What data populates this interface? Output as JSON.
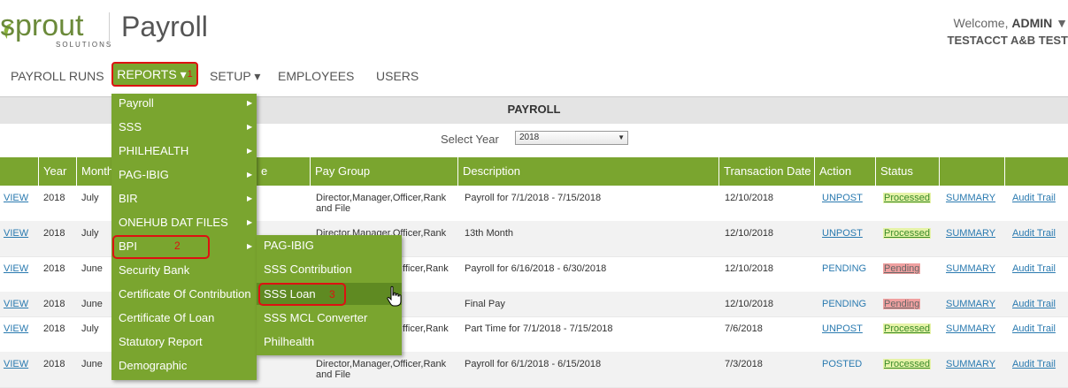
{
  "header": {
    "logo_word": "sprout",
    "logo_sub": "SOLUTIONS",
    "app_title": "Payroll",
    "welcome_prefix": "Welcome,",
    "welcome_user": "ADMIN",
    "company": "TESTACCT A&B TEST"
  },
  "nav": {
    "payroll_runs": "PAYROLL RUNS",
    "reports": "REPORTS ▾",
    "reports_badge": "1",
    "setup": "SETUP ▾",
    "employees": "EMPLOYEES",
    "users": "USERS"
  },
  "page": {
    "title": "PAYROLL",
    "year_label": "Select Year",
    "year_value": "2018"
  },
  "table": {
    "headers": [
      "Year",
      "Month",
      "Pay Group",
      "Description",
      "Transaction Date",
      "Action",
      "Status"
    ],
    "rows": [
      {
        "view": "VIEW",
        "year": "2018",
        "month": "July",
        "group1": "Director,Manager,Officer,Rank",
        "group2": "and File",
        "desc": "Payroll for 7/1/2018 - 7/15/2018",
        "date": "12/10/2018",
        "action": "UNPOST",
        "status": "Processed",
        "summary": "SUMMARY",
        "audit": "Audit Trail"
      },
      {
        "view": "VIEW",
        "year": "2018",
        "month": "July",
        "group1": "Director,Manager,Officer,Rank",
        "group2": "",
        "desc": "13th Month",
        "date": "12/10/2018",
        "action": "UNPOST",
        "status": "Processed",
        "summary": "SUMMARY",
        "audit": "Audit Trail"
      },
      {
        "view": "VIEW",
        "year": "2018",
        "month": "June",
        "group1": "fficer,Rank",
        "group2": "",
        "desc": "Payroll for 6/16/2018 - 6/30/2018",
        "date": "12/10/2018",
        "action": "PENDING",
        "status": "Pending",
        "summary": "SUMMARY",
        "audit": "Audit Trail"
      },
      {
        "view": "VIEW",
        "year": "2018",
        "month": "June",
        "group1": "",
        "group2": "",
        "desc": "Final Pay",
        "date": "12/10/2018",
        "action": "PENDING",
        "status": "Pending",
        "summary": "SUMMARY",
        "audit": "Audit Trail"
      },
      {
        "view": "VIEW",
        "year": "2018",
        "month": "July",
        "group1": "fficer,Rank",
        "group2": "",
        "desc": "Part Time for 7/1/2018 - 7/15/2018",
        "date": "7/6/2018",
        "action": "UNPOST",
        "status": "Processed",
        "summary": "SUMMARY",
        "audit": "Audit Trail"
      },
      {
        "view": "VIEW",
        "year": "2018",
        "month": "June",
        "group1": "Director,Manager,Officer,Rank",
        "group2": "and File",
        "desc": "Payroll for 6/1/2018 - 6/15/2018",
        "date": "7/3/2018",
        "action": "POSTED",
        "status": "Processed",
        "summary": "SUMMARY",
        "audit": "Audit Trail"
      }
    ]
  },
  "menu_reports": {
    "items": [
      "Payroll",
      "SSS",
      "PHILHEALTH",
      "PAG-IBIG",
      "BIR",
      "ONEHUB DAT FILES",
      "BPI",
      "Security Bank",
      "Certificate Of Contribution",
      "Certificate Of Loan",
      "Statutory Report",
      "Demographic"
    ],
    "bpi_badge": "2"
  },
  "menu_bpi": {
    "items": [
      "PAG-IBIG",
      "SSS Contribution",
      "SSS Loan",
      "SSS MCL Converter",
      "Philhealth"
    ],
    "loan_badge": "3"
  },
  "colors": {
    "accent": "#7aa52f",
    "accent_dark": "#5f8a22",
    "highlight_red": "#dd1111"
  }
}
